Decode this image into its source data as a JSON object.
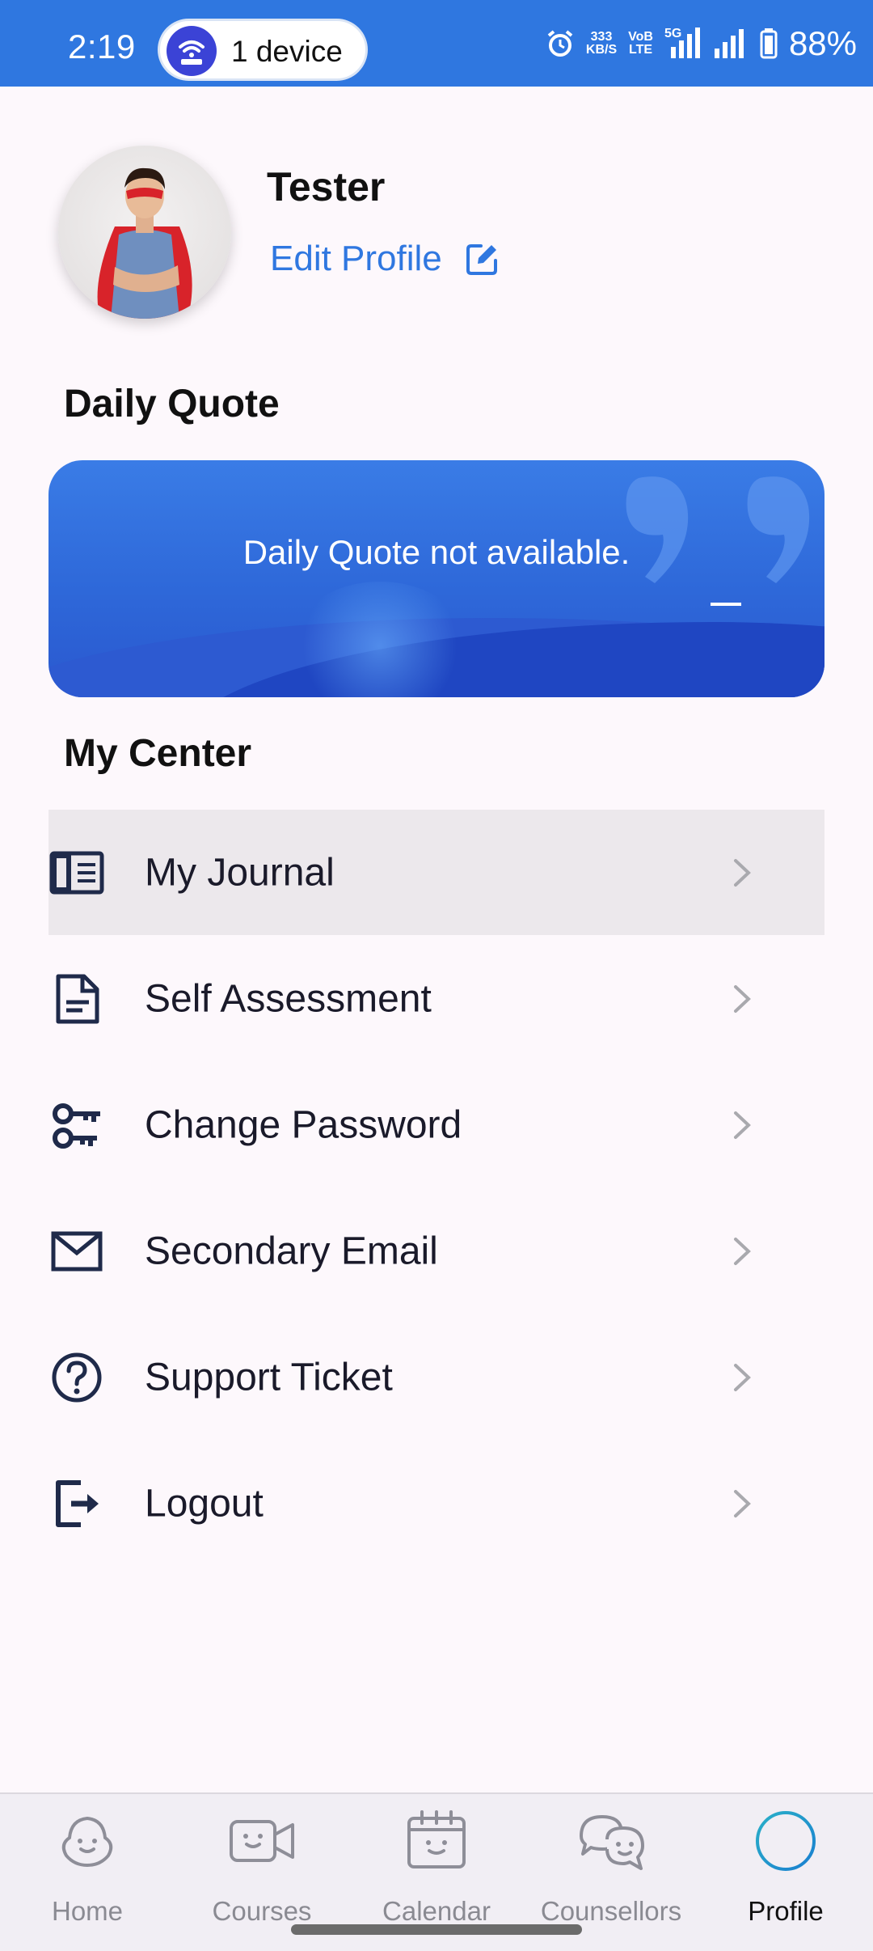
{
  "status_bar": {
    "time": "2:19",
    "hotspot_label": "1 device",
    "net_speed_value": "333",
    "net_speed_unit": "KB/S",
    "volte_top": "VoB",
    "volte_bottom": "LTE",
    "network_type": "5G",
    "battery": "88%"
  },
  "profile": {
    "name": "Tester",
    "edit_label": "Edit Profile"
  },
  "daily_quote": {
    "title": "Daily Quote",
    "text": "Daily Quote not available."
  },
  "my_center": {
    "title": "My Center",
    "items": [
      {
        "label": "My Journal",
        "icon": "journal-icon"
      },
      {
        "label": "Self Assessment",
        "icon": "document-icon"
      },
      {
        "label": "Change Password",
        "icon": "key-icon"
      },
      {
        "label": "Secondary Email",
        "icon": "mail-icon"
      },
      {
        "label": "Support Ticket",
        "icon": "help-icon"
      },
      {
        "label": "Logout",
        "icon": "logout-icon"
      }
    ]
  },
  "bottom_nav": {
    "tabs": [
      {
        "label": "Home",
        "icon": "home-icon"
      },
      {
        "label": "Courses",
        "icon": "video-icon"
      },
      {
        "label": "Calendar",
        "icon": "calendar-icon"
      },
      {
        "label": "Counsellors",
        "icon": "chat-icon"
      },
      {
        "label": "Profile",
        "icon": "profile-icon"
      }
    ],
    "selected": "Profile"
  },
  "colors": {
    "accent": "#2f77e0",
    "background": "#fdf8fc",
    "nav_background": "#f1eef4",
    "icon_dark": "#1f2a4a"
  }
}
